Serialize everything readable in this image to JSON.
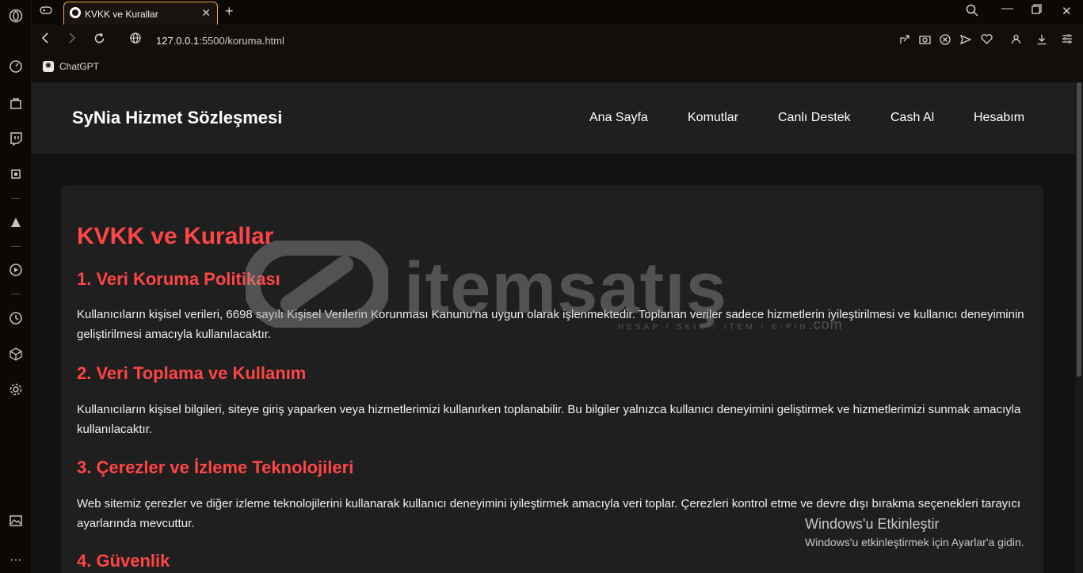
{
  "browser": {
    "tab_title": "KVKK ve Kurallar",
    "url_host": "127.0.0.1",
    "url_rest": ":5500/koruma.html",
    "bookmark_label": "ChatGPT"
  },
  "site": {
    "title": "SyNia Hizmet Sözleşmesi",
    "nav": [
      "Ana Sayfa",
      "Komutlar",
      "Canlı Destek",
      "Cash Al",
      "Hesabım"
    ]
  },
  "content": {
    "heading": "KVKK ve Kurallar",
    "sections": [
      {
        "title": "1. Veri Koruma Politikası",
        "body": "Kullanıcıların kişisel verileri, 6698 sayılı Kişisel Verilerin Korunması Kanunu'na uygun olarak işlenmektedir. Toplanan veriler sadece hizmetlerin iyileştirilmesi ve kullanıcı deneyiminin geliştirilmesi amacıyla kullanılacaktır."
      },
      {
        "title": "2. Veri Toplama ve Kullanım",
        "body": "Kullanıcıların kişisel bilgileri, siteye giriş yaparken veya hizmetlerimizi kullanırken toplanabilir. Bu bilgiler yalnızca kullanıcı deneyimini geliştirmek ve hizmetlerimizi sunmak amacıyla kullanılacaktır."
      },
      {
        "title": "3. Çerezler ve İzleme Teknolojileri",
        "body": "Web sitemiz çerezler ve diğer izleme teknolojilerini kullanarak kullanıcı deneyimini iyileştirmek amacıyla veri toplar. Çerezleri kontrol etme ve devre dışı bırakma seçenekleri tarayıcı ayarlarında mevcuttur."
      },
      {
        "title": "4. Güvenlik",
        "body": ""
      }
    ]
  },
  "watermark": {
    "text": "itemsatış",
    "sub": "HESAP / SKIN / ITEM / E-PIN",
    "sub_suffix": ".com"
  },
  "os_overlay": {
    "title": "Windows'u Etkinleştir",
    "subtitle": "Windows'u etkinleştirmek için Ayarlar'a gidin."
  },
  "colors": {
    "accent_heading": "#ff4545",
    "tab_outline": "#f2a33a",
    "header_bg": "#1f1f1f"
  }
}
